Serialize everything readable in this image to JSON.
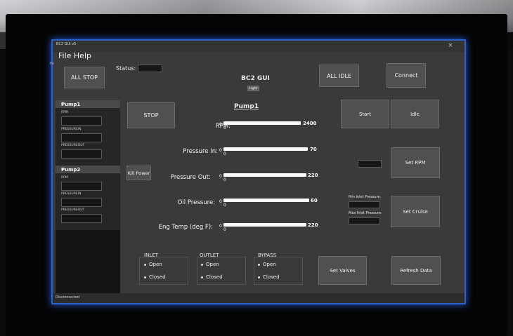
{
  "window": {
    "title": "BC2 GUI v5",
    "close_glyph": "×",
    "menu": "File Help",
    "side_char": "Fe"
  },
  "header": {
    "all_stop": "ALL STOP",
    "status_label": "Status:",
    "app_title": "BC2 GUI",
    "theme_toggle": "Light",
    "all_idle": "ALL IDLE",
    "connect": "Connect"
  },
  "sidebar": {
    "pump1": {
      "header": "Pump1",
      "rpm_label": "RPM",
      "pin_label": "PRESSUREIN",
      "pout_label": "PRESSUREOUT"
    },
    "pump2": {
      "header": "Pump2",
      "rpm_label": "RPM",
      "pin_label": "PRESSUREIN",
      "pout_label": "PRESSUREOUT"
    },
    "collapse_glyph": "▾"
  },
  "pump_panel": {
    "title": "Pump1",
    "stop": "STOP",
    "kill_power": "Kill Power",
    "start": "Start",
    "idle": "Idle",
    "set_rpm": "Set RPM",
    "min_inlet_label": "Min Inlet Pressure:",
    "max_inlet_label": "Max Inlet Pressure:",
    "set_cruise": "Set Cruise",
    "set_valves": "Set Valves",
    "refresh_data": "Refresh Data"
  },
  "gauges": [
    {
      "label": "RPM:",
      "min": "0",
      "max": "2400",
      "zero": "0",
      "level": 1.0
    },
    {
      "label": "Pressure In:",
      "min": "0",
      "max": "70",
      "zero": "0",
      "level": 1.0
    },
    {
      "label": "Pressure Out:",
      "min": "0",
      "max": "220",
      "zero": "0",
      "level": 1.0
    },
    {
      "label": "Oil Pressure:",
      "min": "0",
      "max": "60",
      "zero": "0",
      "level": 1.0
    },
    {
      "label": "Eng Temp (deg F):",
      "min": "0",
      "max": "220",
      "zero": "0",
      "level": 1.0
    }
  ],
  "valves": [
    {
      "name": "INLET",
      "open": "Open",
      "closed": "Closed"
    },
    {
      "name": "OUTLET",
      "open": "Open",
      "closed": "Closed"
    },
    {
      "name": "BYPASS",
      "open": "Open",
      "closed": "Closed"
    }
  ],
  "statusbar": {
    "text": "Disconnected"
  }
}
